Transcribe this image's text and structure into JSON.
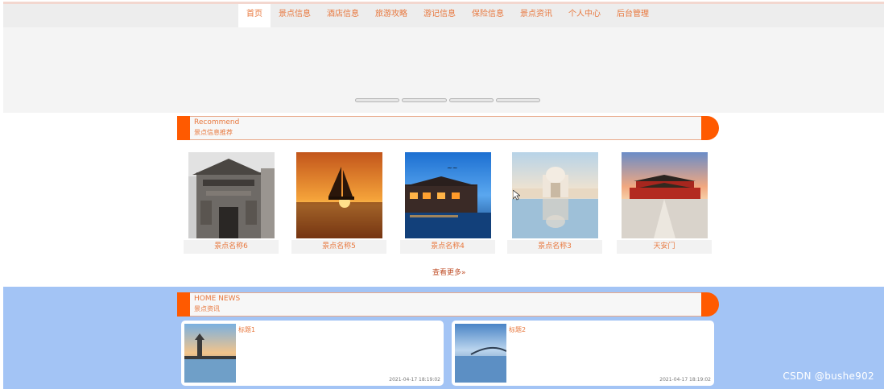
{
  "nav": {
    "items": [
      {
        "label": "首页",
        "active": true
      },
      {
        "label": "景点信息",
        "active": false
      },
      {
        "label": "酒店信息",
        "active": false
      },
      {
        "label": "旅游攻略",
        "active": false
      },
      {
        "label": "游记信息",
        "active": false
      },
      {
        "label": "保险信息",
        "active": false
      },
      {
        "label": "景点资讯",
        "active": false
      },
      {
        "label": "个人中心",
        "active": false
      },
      {
        "label": "后台管理",
        "active": false
      }
    ]
  },
  "banner": {
    "slide_count": 4,
    "active_slide": 1
  },
  "recommend": {
    "title_en": "Recommend",
    "title_cn": "景点信息推荐",
    "items": [
      {
        "name": "景点名称6",
        "image": "ancient-gate-photo"
      },
      {
        "name": "景点名称5",
        "image": "sailboat-sunset-photo"
      },
      {
        "name": "景点名称4",
        "image": "water-town-night-photo"
      },
      {
        "name": "景点名称3",
        "image": "white-palace-reflection-photo"
      },
      {
        "name": "天安门",
        "image": "forbidden-city-photo"
      }
    ],
    "more_label": "查看更多»"
  },
  "news": {
    "title_en": "HOME NEWS",
    "title_cn": "景点资讯",
    "items": [
      {
        "title": "标题1",
        "date": "2021-04-17 18:19:02",
        "image": "pagoda-lake-photo"
      },
      {
        "title": "标题2",
        "date": "2021-04-17 18:19:02",
        "image": "bridge-sea-photo"
      }
    ]
  },
  "watermark": "CSDN @bushe902",
  "colors": {
    "accent": "#ff5a00",
    "text_orange": "#e8783e",
    "news_bg": "#a3c4f5",
    "nav_bg": "#ededed"
  }
}
